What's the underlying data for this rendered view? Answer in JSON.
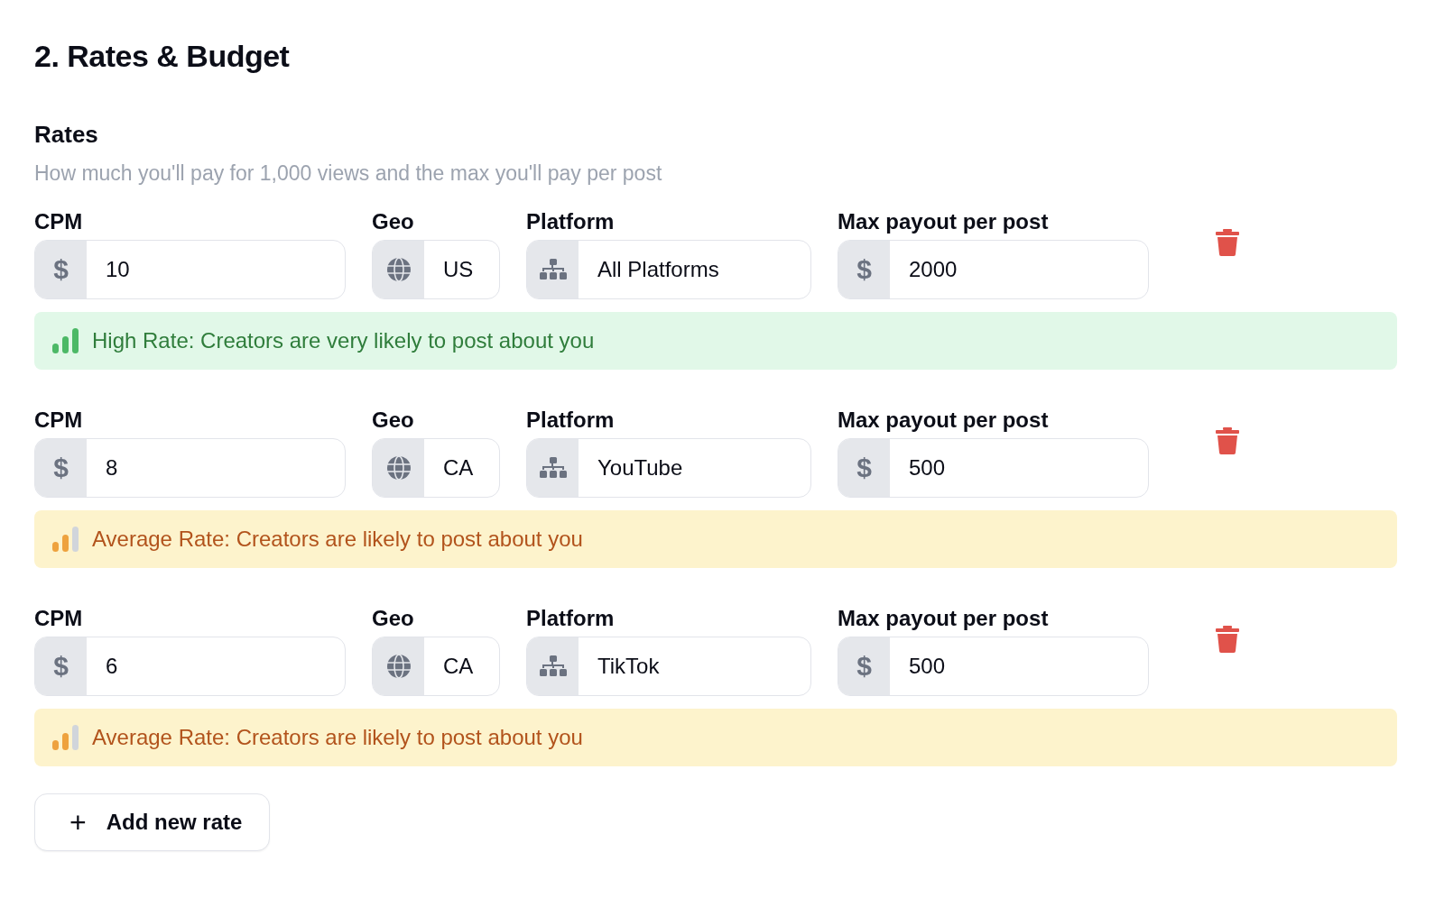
{
  "section_title": "2. Rates & Budget",
  "rates_heading": "Rates",
  "rates_description": "How much you'll pay for 1,000 views and the max you'll pay per post",
  "rates": [
    {
      "cpm_label": "CPM",
      "cpm_prefix": "$",
      "cpm": "10",
      "geo_label": "Geo",
      "geo": "US",
      "platform_label": "Platform",
      "platform": "All Platforms",
      "max_label": "Max payout per post",
      "max_prefix": "$",
      "max_payout": "2000",
      "note": {
        "kind": "high",
        "text": "High Rate: Creators are very likely to post about you"
      }
    },
    {
      "cpm_label": "CPM",
      "cpm_prefix": "$",
      "cpm": "8",
      "geo_label": "Geo",
      "geo": "CA",
      "platform_label": "Platform",
      "platform": "YouTube",
      "max_label": "Max payout per post",
      "max_prefix": "$",
      "max_payout": "500",
      "note": {
        "kind": "average",
        "text": "Average Rate: Creators are likely to post about you"
      }
    },
    {
      "cpm_label": "CPM",
      "cpm_prefix": "$",
      "cpm": "6",
      "geo_label": "Geo",
      "geo": "CA",
      "platform_label": "Platform",
      "platform": "TikTok",
      "max_label": "Max payout per post",
      "max_prefix": "$",
      "max_payout": "500",
      "note": {
        "kind": "average",
        "text": "Average Rate: Creators are likely to post about you"
      }
    }
  ],
  "add_button": {
    "icon": "+",
    "label": "Add new rate"
  }
}
